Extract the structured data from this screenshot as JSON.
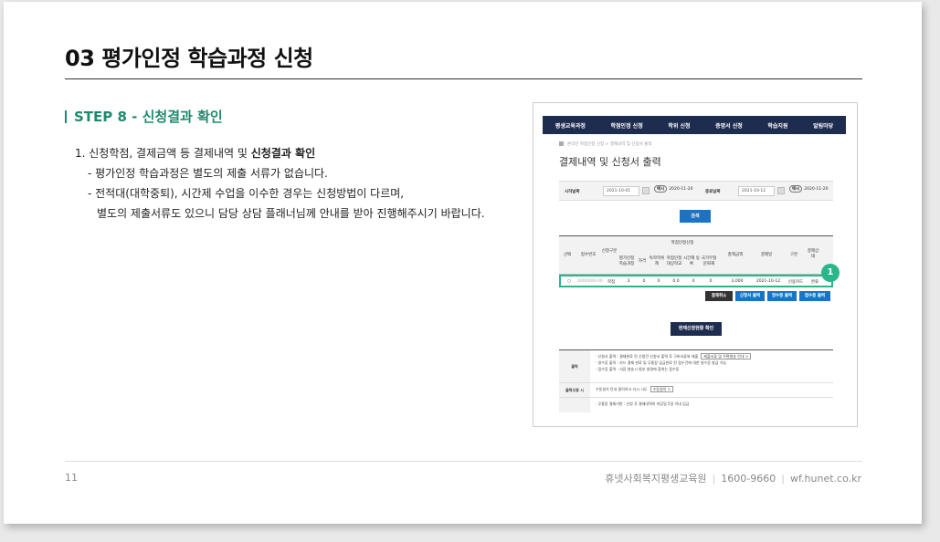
{
  "header": {
    "title": "03  평가인정 학습과정 신청"
  },
  "section": {
    "step_title": "STEP 8 - 신청결과 확인"
  },
  "content": {
    "item1_prefix": "1. 신청학점, 결제금액 등 결제내역 및 ",
    "item1_bold": "신청결과 확인",
    "sub1": "- 평가인정 학습과정은 별도의 제출 서류가 없습니다.",
    "sub2": "- 전적대(대학중퇴), 시간제 수업을 이수한 경우는 신청방법이 다르며,",
    "sub3": "별도의 제출서류도 있으니 담당 상담 플래너님께 안내를 받아 진행해주시기 바랍니다."
  },
  "screenshot": {
    "nav": [
      "평생교육과정",
      "학점인정 신청",
      "학위 신청",
      "증명서 신청",
      "학습지원",
      "알림마당"
    ],
    "breadcrumb": "온라인 학점인정 신청 > 결제내역 및 신청서 출력",
    "heading": "결제내역 및 신청서 출력",
    "filter": {
      "start_label": "시작날짜",
      "start_value": "2021-10-01",
      "start_example_tag": "예시",
      "start_example": "2020-11-20",
      "end_label": "종료날짜",
      "end_value": "2021-10-12",
      "end_example_tag": "예시",
      "end_example": "2020-11-20"
    },
    "search_button": "검색",
    "table": {
      "group_header": "학점인정신청",
      "headers": [
        "선택",
        "접수번호",
        "신청구분",
        "평가인정 학습과정",
        "자격",
        "독학학위제",
        "학점인정 대상학교",
        "시간제 등록",
        "국가무형 문화재",
        "총액금액",
        "결제일",
        "구분",
        "결제상태"
      ],
      "row": [
        "○",
        "0000000-00",
        "학점",
        "3",
        "0",
        "0",
        "0.0",
        "0",
        "0",
        "3,000",
        "2021-10-12",
        "신용카드",
        "완료"
      ]
    },
    "badge": "1",
    "action_buttons": [
      "결제취소",
      "신청서 출력",
      "영수증 출력",
      "접수증 출력"
    ],
    "status_button": "현재신청현황 확인",
    "info": {
      "print_label": "출력",
      "print_lines": [
        "· 신청서 출력 : 결제완료 된 신청건 신청서 출력 후 구비서류와 제출",
        "· 영수증 출력 : 카드 결제 완료 및 무통장 입금완료 된 접수건에 대한 영수증 발급 가능",
        "· 접수증 출력 : 서류 발송시 첨부 설명에 참여는 접수증"
      ],
      "print_tag": "제출서류 및 우편발송 안내 >",
      "error_label": "출력오류 시",
      "error_line": "수동설치 안내 클릭하고 다시 시도",
      "error_tag": "수동설치 >",
      "note_line": "· 무통장 결제기한 : 신청 후 결제내역의 마감일 5일 이내 입금"
    }
  },
  "footer": {
    "page": "11",
    "org": "휴넷사회복지평생교육원",
    "phone": "1600-9660",
    "site": "wf.hunet.co.kr"
  }
}
